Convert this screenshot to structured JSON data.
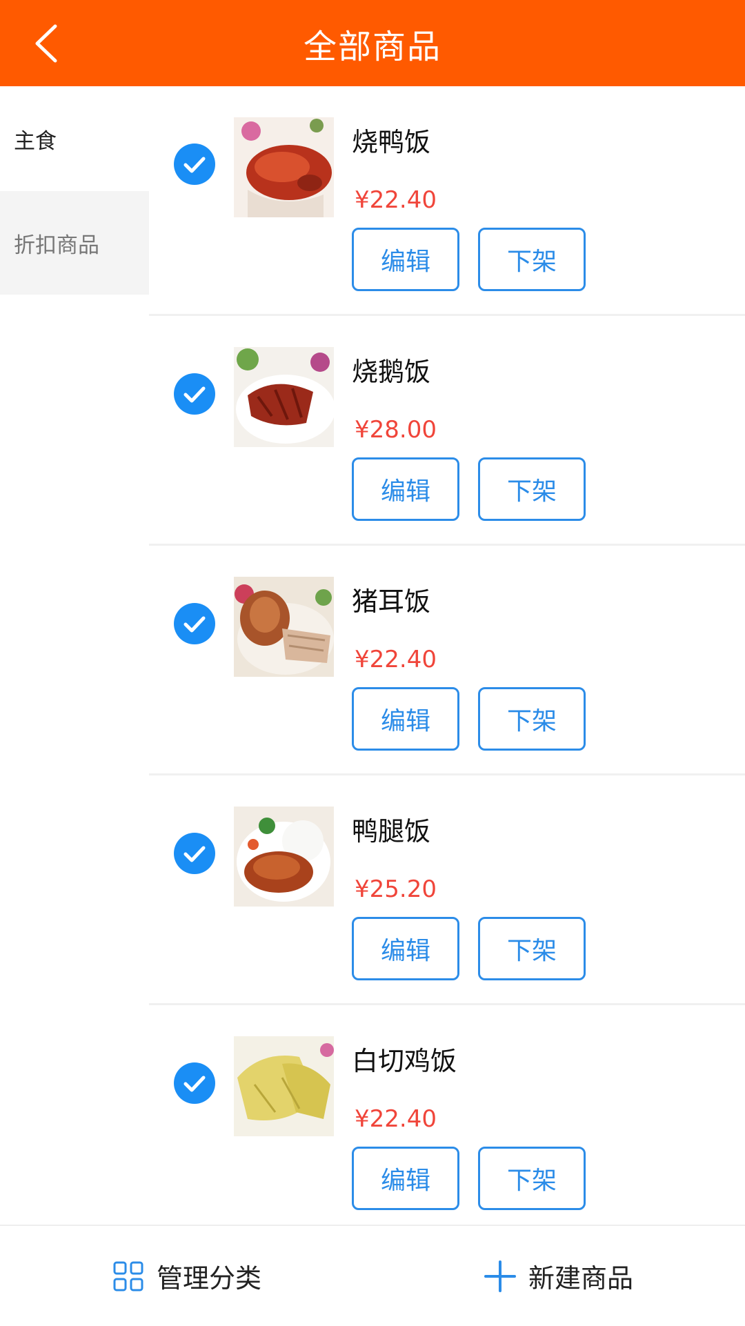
{
  "header": {
    "title": "全部商品"
  },
  "sidebar": {
    "items": [
      {
        "label": "主食"
      },
      {
        "label": "折扣商品"
      }
    ]
  },
  "products": [
    {
      "name": "烧鸭饭",
      "price": "¥22.40",
      "edit_label": "编辑",
      "off_label": "下架"
    },
    {
      "name": "烧鹅饭",
      "price": "¥28.00",
      "edit_label": "编辑",
      "off_label": "下架"
    },
    {
      "name": "猪耳饭",
      "price": "¥22.40",
      "edit_label": "编辑",
      "off_label": "下架"
    },
    {
      "name": "鸭腿饭",
      "price": "¥25.20",
      "edit_label": "编辑",
      "off_label": "下架"
    },
    {
      "name": "白切鸡饭",
      "price": "¥22.40",
      "edit_label": "编辑",
      "off_label": "下架"
    }
  ],
  "footer": {
    "manage_label": "管理分类",
    "create_label": "新建商品"
  },
  "colors": {
    "brand": "#ff5a00",
    "accent": "#1a8ef5",
    "price": "#f0453a"
  }
}
